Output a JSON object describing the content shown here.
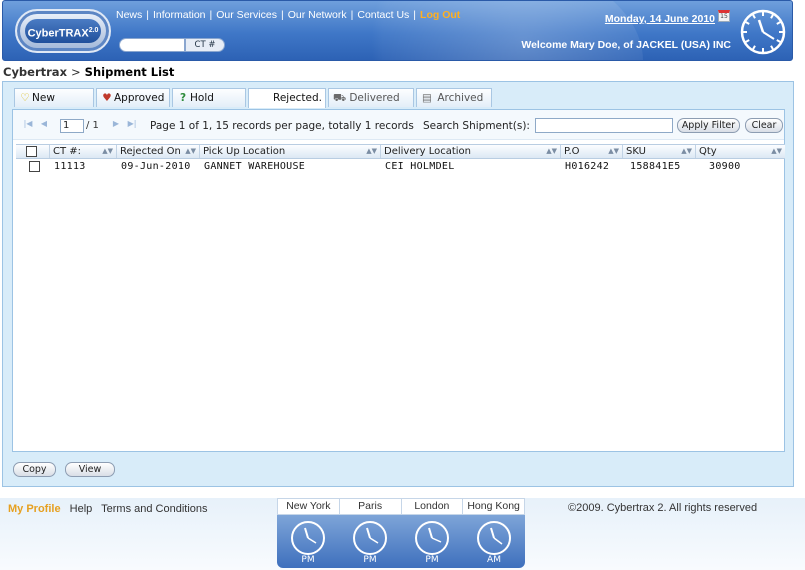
{
  "header": {
    "logo_text": "CyberTRAX",
    "logo_version": "2.0",
    "nav": [
      "News",
      "Information",
      "Our Services",
      "Our Network",
      "Contact Us"
    ],
    "logout": "Log Out",
    "search_button": "CT #",
    "date": "Monday, 14 June 2010",
    "calendar_day": "15",
    "welcome": "Welcome Mary Doe, of JACKEL (USA) INC"
  },
  "breadcrumb": {
    "root": "Cybertrax",
    "separator": ">",
    "current": "Shipment List"
  },
  "tabs": [
    {
      "label": "New",
      "icon": "heart-outline-icon"
    },
    {
      "label": "Approved",
      "icon": "heart-icon"
    },
    {
      "label": "Hold",
      "icon": "question-icon"
    },
    {
      "label": "Rejected.",
      "icon": "",
      "active": true
    },
    {
      "label": "Delivered",
      "icon": "truck-icon"
    },
    {
      "label": "Archived",
      "icon": "archive-icon"
    }
  ],
  "pager": {
    "page_value": "1",
    "total_pages": "/ 1",
    "info": "Page 1 of 1, 15 records per page, totally 1 records",
    "search_label": "Search Shipment(s):",
    "search_value": "",
    "apply_label": "Apply Filter",
    "clear_label": "Clear"
  },
  "grid": {
    "columns": [
      "CT #:",
      "Rejected On",
      "Pick Up Location",
      "Delivery Location",
      "P.O",
      "SKU",
      "Qty"
    ],
    "rows": [
      {
        "ct": "11113",
        "rejected_on": "09-Jun-2010",
        "pickup": "GANNET WAREHOUSE",
        "delivery": "CEI HOLMDEL",
        "po": "H016242",
        "sku": "158841E5",
        "qty": "30900"
      }
    ]
  },
  "actions": {
    "copy_label": "Copy",
    "view_label": "View"
  },
  "footer": {
    "profile": "My Profile",
    "help": "Help",
    "terms": "Terms and Conditions",
    "copyright": "©2009. Cybertrax 2. All rights reserved",
    "clocks": [
      {
        "city": "New York",
        "period": "PM"
      },
      {
        "city": "Paris",
        "period": "PM"
      },
      {
        "city": "London",
        "period": "PM"
      },
      {
        "city": "Hong Kong",
        "period": "AM"
      }
    ]
  },
  "colors": {
    "header_blue": "#3f77c7",
    "panel_bg": "#d8ecf9",
    "logout_orange": "#ffb020",
    "profile_orange": "#e6a020"
  }
}
